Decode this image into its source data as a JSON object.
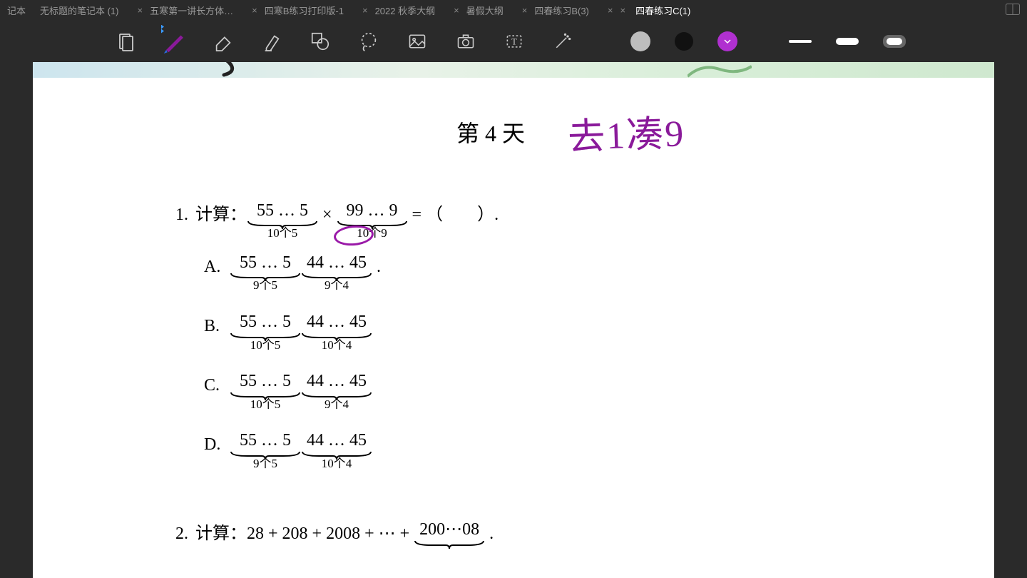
{
  "tabs": [
    {
      "label": "记本",
      "closable": false
    },
    {
      "label": "无标题的笔记本 (1)",
      "closable": true
    },
    {
      "label": "五寒第一讲长方体…",
      "closable": true
    },
    {
      "label": "四寒B练习打印版-1",
      "closable": true
    },
    {
      "label": "2022 秋季大纲",
      "closable": true
    },
    {
      "label": "暑假大纲",
      "closable": true
    },
    {
      "label": "四春练习B(3)",
      "closable": true
    },
    {
      "label": "四春练习C(1)",
      "closable": true,
      "active": true
    }
  ],
  "toolbar": {
    "colors": {
      "light": "#bdbdbd",
      "dark": "#111111",
      "accent": "#b030d0"
    }
  },
  "page": {
    "title": "第 4 天",
    "handwriting": "去1凑9",
    "problems": [
      {
        "num": "1.",
        "stem_prefix": "计算：",
        "expr": {
          "lhs": [
            {
              "text": "55 … 5",
              "sub": "10个5"
            },
            {
              "op": " × "
            },
            {
              "text": "99 … 9",
              "sub": "10个9",
              "circled": true
            }
          ],
          "rhs": " = （　　）."
        },
        "options": [
          {
            "label": "A.",
            "parts": [
              {
                "text": "55 … 5",
                "sub": "9个5"
              },
              {
                "text": "44 … 45",
                "sub": "9个4"
              }
            ],
            "tail": " ."
          },
          {
            "label": "B.",
            "parts": [
              {
                "text": "55 … 5",
                "sub": "10个5"
              },
              {
                "text": "44 … 45",
                "sub": "10个4"
              }
            ],
            "tail": ""
          },
          {
            "label": "C.",
            "parts": [
              {
                "text": "55 … 5",
                "sub": "10个5"
              },
              {
                "text": "44 … 45",
                "sub": "9个4"
              }
            ],
            "tail": ""
          },
          {
            "label": "D.",
            "parts": [
              {
                "text": "55 … 5",
                "sub": "9个5"
              },
              {
                "text": "44 … 45",
                "sub": "10个4"
              }
            ],
            "tail": ""
          }
        ]
      },
      {
        "num": "2.",
        "stem_prefix": "计算：",
        "expr_plain": "28 + 208 + 2008 + ⋯ + ",
        "tail_ub": {
          "text": "200⋯08",
          "sub": ""
        },
        "tail": " ."
      }
    ]
  }
}
